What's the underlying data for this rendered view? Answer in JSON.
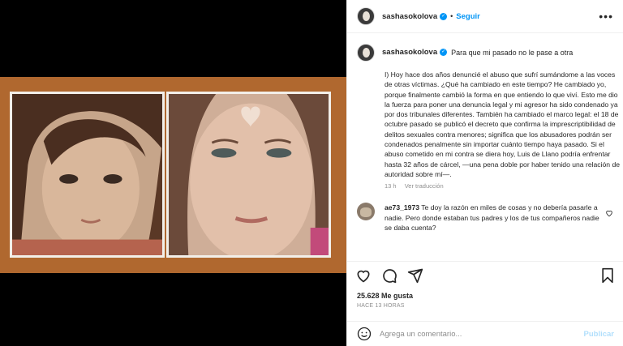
{
  "post": {
    "username": "sashasokolova",
    "follow_label": "Seguir",
    "caption_title": "Para que mi pasado no le pase a otra",
    "caption_text": "I) Hoy hace dos años denuncié el abuso que sufrí sumándome a las voces de otras víctimas. ¿Qué ha cambiado en este tiempo? He cambiado yo, porque finalmente cambió la forma en que entiendo lo que viví. Esto me dio la fuerza para poner una denuncia legal y mi agresor ha sido condenado ya por dos tribunales diferentes. También ha cambiado el marco legal: el 18 de octubre pasado se publicó el decreto que confirma la imprescriptibilidad de delitos sexuales contra menores; significa que los abusadores podrán ser condenados penalmente sin importar cuánto tiempo haya pasado. Si el abuso cometido en mi contra se diera hoy, Luis de Llano podría enfrentar hasta 32 años de cárcel, —una pena doble por haber tenido una relación de autoridad sobre mí—.",
    "caption_age": "13 h",
    "translate_label": "Ver traducción",
    "likes": "25.628 Me gusta",
    "timestamp": "HACE 13 HORAS"
  },
  "comments": [
    {
      "username": "ae73_1973",
      "text": "Te doy la razón en miles de cosas y no debería pasarle a nadie. Pero donde estaban tus padres y los de tus compañeros nadie se daba cuenta?"
    }
  ],
  "composer": {
    "placeholder": "Agrega un comentario...",
    "post_label": "Publicar"
  },
  "colors": {
    "accent": "#0095f6",
    "frame": "#b0682f"
  },
  "icons": [
    "more-options-icon",
    "verified-badge-icon",
    "heart-icon",
    "comment-icon",
    "share-icon",
    "bookmark-icon",
    "emoji-icon"
  ]
}
